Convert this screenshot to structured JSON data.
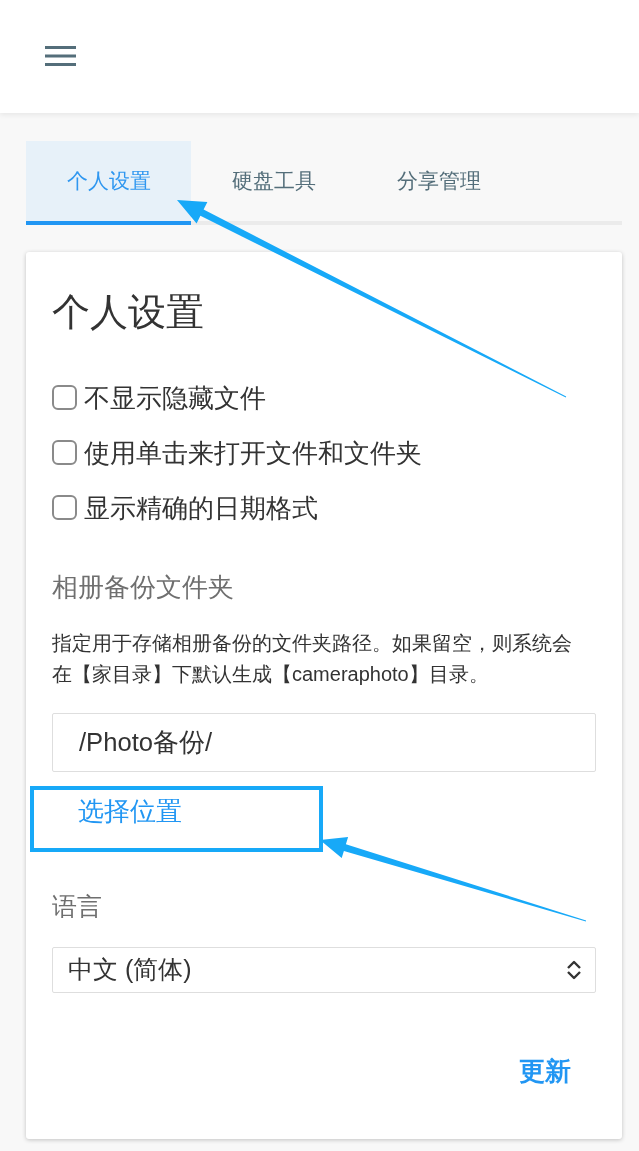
{
  "tabs": [
    {
      "label": "个人设置",
      "selected": true
    },
    {
      "label": "硬盘工具",
      "selected": false
    },
    {
      "label": "分享管理",
      "selected": false
    }
  ],
  "settings": {
    "title": "个人设置",
    "options": [
      {
        "label": "不显示隐藏文件",
        "checked": false
      },
      {
        "label": "使用单击来打开文件和文件夹",
        "checked": false
      },
      {
        "label": "显示精确的日期格式",
        "checked": false
      }
    ],
    "album_backup": {
      "label": "相册备份文件夹",
      "description": "指定用于存储相册备份的文件夹路径。如果留空，则系统会在【家目录】下默认生成【cameraphoto】目录。",
      "value": "/Photo备份/",
      "choose_button": "选择位置"
    },
    "language": {
      "label": "语言",
      "value": "中文 (简体)"
    },
    "update_button": "更新"
  }
}
